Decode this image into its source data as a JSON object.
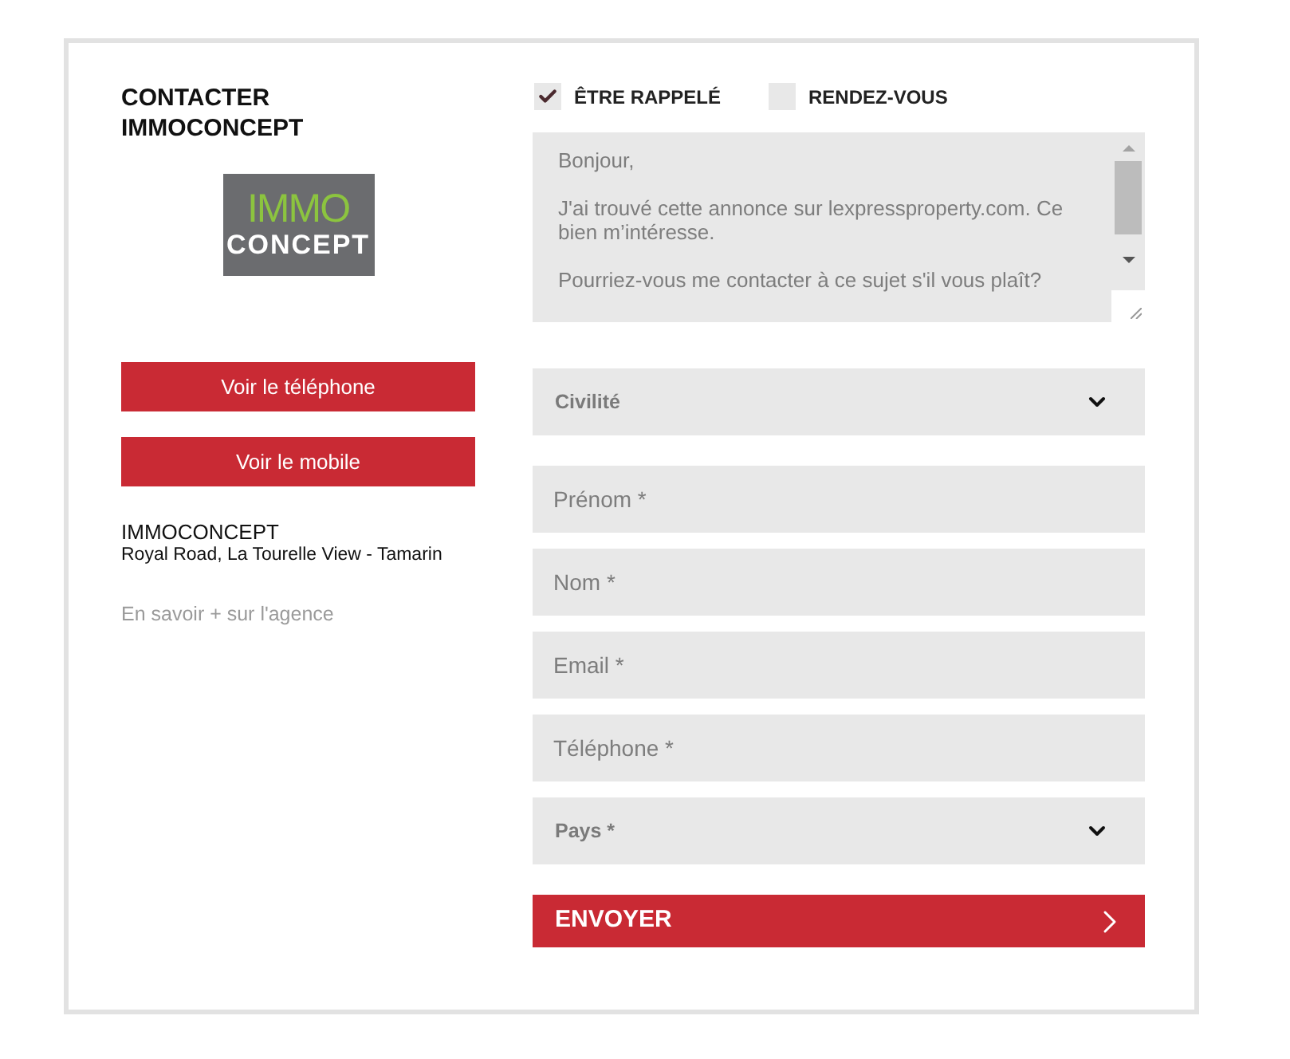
{
  "heading": "CONTACTER IMMOCONCEPT",
  "logo": {
    "top": "IMMO",
    "bottom": "CONCEPT"
  },
  "buttons": [
    {
      "label": "Voir le téléphone"
    },
    {
      "label": "Voir le mobile"
    }
  ],
  "agency": {
    "name": "IMMOCONCEPT",
    "address": "Royal Road, La Tourelle View - Tamarin",
    "link": "En savoir + sur l'agence"
  },
  "options": [
    {
      "label": "ÊTRE RAPPELÉ",
      "checked": true
    },
    {
      "label": "RENDEZ-VOUS",
      "checked": false
    }
  ],
  "message": {
    "value": "Bonjour,\n\nJ'ai trouvé cette annonce sur lexpressproperty.com. Ce bien m’intéresse.\n\nPourriez-vous me contacter à ce sujet s'il vous plaît?"
  },
  "fields": [
    {
      "kind": "select",
      "placeholder": "Civilité"
    },
    {
      "kind": "text",
      "placeholder": "Prénom *"
    },
    {
      "kind": "text",
      "placeholder": "Nom *"
    },
    {
      "kind": "text",
      "placeholder": "Email *"
    },
    {
      "kind": "text",
      "placeholder": "Téléphone *"
    },
    {
      "kind": "select",
      "placeholder": "Pays *"
    }
  ],
  "submit": {
    "label": "ENVOYER"
  }
}
